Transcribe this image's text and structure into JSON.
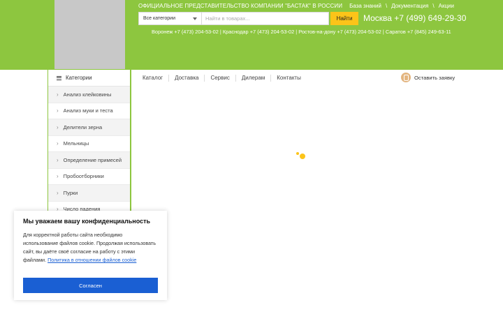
{
  "header": {
    "tagline": "ОФИЦИАЛЬНОЕ ПРЕДСТАВИТЕЛЬСТВО КОМПАНИИ \"БАСТАК\" В РОССИИ",
    "top_links": [
      "База знаний",
      "Документация",
      "Акции"
    ],
    "separator": "\\",
    "search": {
      "category": "Все категории",
      "placeholder": "Найти в товарах...",
      "button": "Найти"
    },
    "phone_main": "Москва +7 (499) 649-29-30",
    "phones": "Воронеж +7 (473) 204-53-02 | Краснодар +7 (473) 204-53-02 | Ростов-на-дону +7 (473) 204-53-02 | Саратов +7 (845) 249-63-11"
  },
  "sidebar": {
    "title": "Категории",
    "items": [
      "Анализ клейковины",
      "Анализ муки и теста",
      "Делители зерна",
      "Мельницы",
      "Определение примесей",
      "Пробоотборники",
      "Пурки",
      "Число падения"
    ]
  },
  "nav": {
    "items": [
      "Каталог",
      "Доставка",
      "Сервис",
      "Дилерам",
      "Контакты"
    ],
    "request": "Оставить заявку"
  },
  "cookie": {
    "title": "Мы уважаем вашу конфиденциальность",
    "text": "Для корректной работы сайта необходимо использование файлов cookie. Продолжая использовать сайт, вы даёте своё согласие на работу с этими файлами.",
    "link": "Политика в отношении файлов cookie",
    "button": "Согласен"
  },
  "colors": {
    "brand_green": "#8dc63f",
    "accent_yellow": "#fcc419",
    "button_blue": "#1a5fd3"
  }
}
